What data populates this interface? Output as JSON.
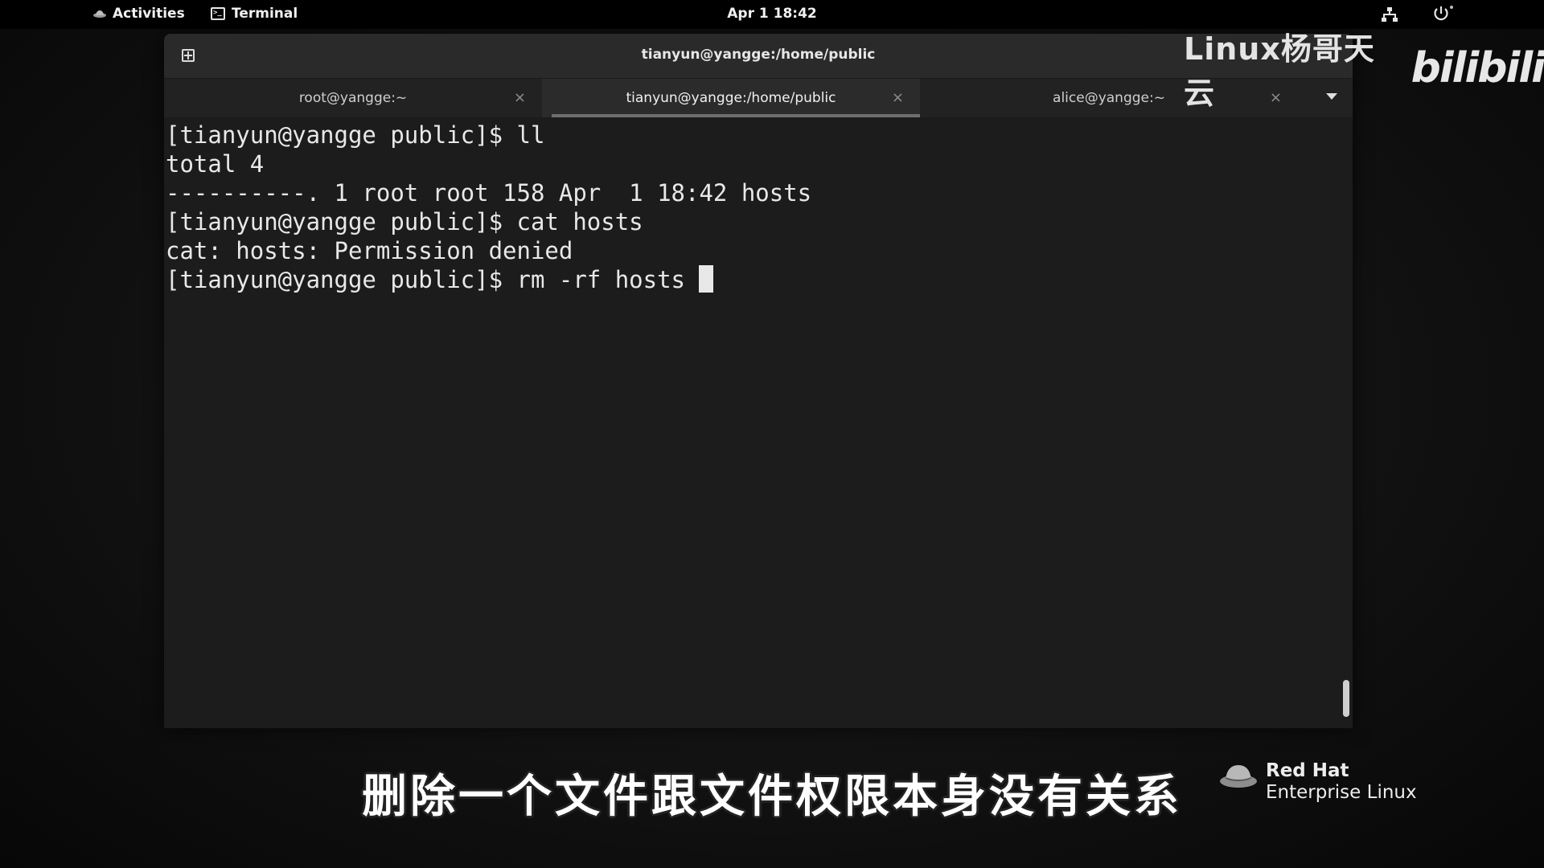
{
  "topbar": {
    "activities_label": "Activities",
    "app_label": "Terminal",
    "clock": "Apr 1  18:42"
  },
  "window": {
    "title": "tianyun@yangge:/home/public",
    "tabs": [
      {
        "label": "root@yangge:~",
        "active": false
      },
      {
        "label": "tianyun@yangge:/home/public",
        "active": true
      },
      {
        "label": "alice@yangge:~",
        "active": false
      }
    ],
    "tab_close_glyph": "×"
  },
  "terminal": {
    "lines": [
      "[tianyun@yangge public]$ ll",
      "total 4",
      "----------. 1 root root 158 Apr  1 18:42 hosts",
      "[tianyun@yangge public]$ cat hosts",
      "cat: hosts: Permission denied",
      "[tianyun@yangge public]$ rm -rf hosts "
    ]
  },
  "overlay": {
    "watermark_text": "Linux杨哥天云",
    "watermark_logo": "bilibili",
    "subtitle": "删除一个文件跟文件权限本身没有关系",
    "redhat_brand": "Red Hat",
    "redhat_product": "Enterprise Linux"
  },
  "icons": {
    "activities": "redhat-hat-icon",
    "app": "terminal-icon",
    "network": "network-wired-icon",
    "power": "power-icon",
    "new_tab": "new-tab-icon",
    "tab_menu": "chevron-down-icon"
  }
}
